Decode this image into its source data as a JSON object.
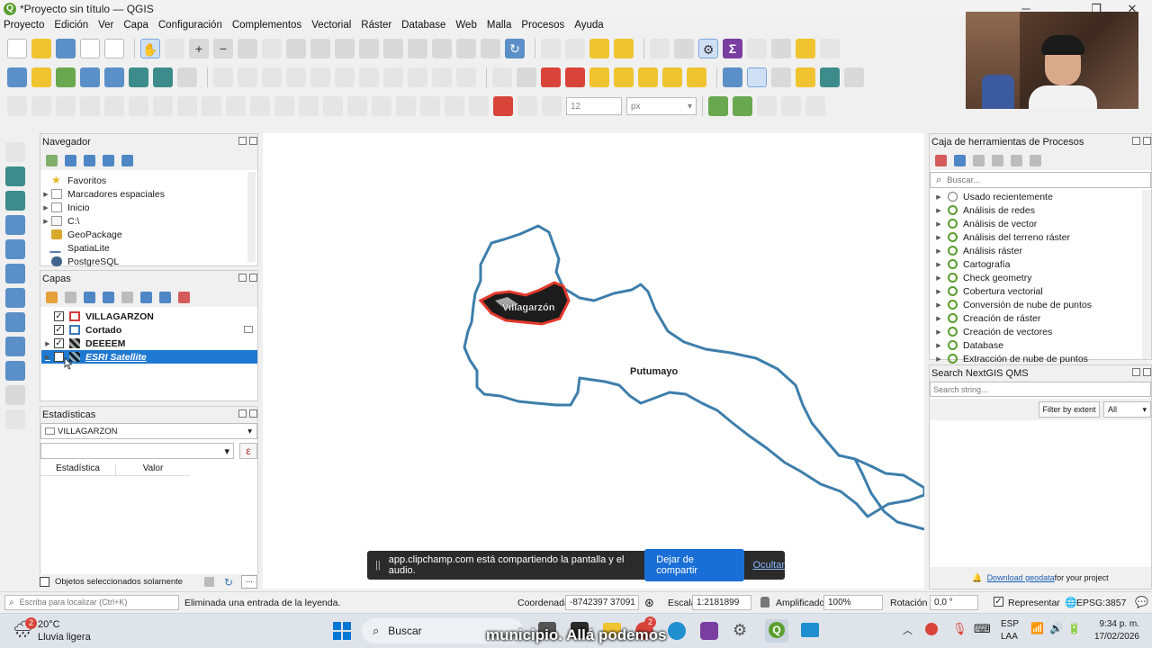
{
  "window": {
    "title": "*Proyecto sin título — QGIS",
    "minimize": "─",
    "maximize": "❐",
    "close": "✕"
  },
  "menu": [
    "Proyecto",
    "Edición",
    "Ver",
    "Capa",
    "Configuración",
    "Complementos",
    "Vectorial",
    "Ráster",
    "Database",
    "Web",
    "Malla",
    "Procesos",
    "Ayuda"
  ],
  "toolbar": {
    "font_size_value": "12",
    "unit_value": "px"
  },
  "navigator": {
    "title": "Navegador",
    "items": [
      {
        "label": "Favoritos",
        "icon": "star-icon",
        "expandable": false
      },
      {
        "label": "Marcadores espaciales",
        "icon": "bookmark-icon",
        "expandable": true
      },
      {
        "label": "Inicio",
        "icon": "folder-icon",
        "expandable": true
      },
      {
        "label": "C:\\",
        "icon": "drive-icon",
        "expandable": true
      },
      {
        "label": "GeoPackage",
        "icon": "geopackage-icon",
        "expandable": false
      },
      {
        "label": "SpatiaLite",
        "icon": "spatialite-icon",
        "expandable": false
      },
      {
        "label": "PostgreSQL",
        "icon": "postgresql-icon",
        "expandable": false
      }
    ]
  },
  "layers": {
    "title": "Capas",
    "items": [
      {
        "label": "VILLAGARZON",
        "checked": true,
        "symbol": "polygon-red-outline",
        "selected": false
      },
      {
        "label": "Cortado",
        "checked": true,
        "symbol": "polygon-blue-outline",
        "selected": false
      },
      {
        "label": "DEEEEM",
        "checked": true,
        "symbol": "raster",
        "selected": false
      },
      {
        "label": "ESRI Satellite",
        "checked": false,
        "symbol": "raster",
        "selected": true
      }
    ]
  },
  "stats": {
    "title": "Estadísticas",
    "layer_value": "VILLAGARZON",
    "expr_button": "ε",
    "col_stat": "Estadística",
    "col_value": "Valor",
    "selected_only_label": "Objetos seleccionados solamente",
    "more_button": "..."
  },
  "map": {
    "label_villagarzon": "Villagarzón",
    "label_putumayo": "Putumayo"
  },
  "share": {
    "message": "app.clipchamp.com está compartiendo la pantalla y el audio.",
    "stop_button": "Dejar de compartir",
    "hide_button": "Ocultar",
    "grip": "||"
  },
  "processing": {
    "title": "Caja de herramientas de Procesos",
    "search_placeholder": "Buscar...",
    "items": [
      "Usado recientemente",
      "Análisis de redes",
      "Análisis de vector",
      "Análisis del terreno ráster",
      "Análisis ráster",
      "Cartografía",
      "Check geometry",
      "Cobertura vectorial",
      "Conversión de nube de puntos",
      "Creación de ráster",
      "Creación de vectores",
      "Database",
      "Extracción de nube de puntos"
    ]
  },
  "nextgis": {
    "title": "Search NextGIS QMS",
    "search_placeholder": "Search string...",
    "filter_button": "Filter by extent",
    "filter_value": "All",
    "download_link": "Download geodata",
    "download_suffix": " for your project"
  },
  "status": {
    "locator_placeholder": "Escriba para localizar (Ctrl+K)",
    "message": "Eliminada una entrada de la leyenda.",
    "coord_label": "Coordenada",
    "coord_value": "-8742397  37091",
    "scale_label": "Escala",
    "scale_value": "1:2181899",
    "magnifier_label": "Amplificador",
    "magnifier_value": "100%",
    "rotation_label": "Rotación",
    "rotation_value": "0,0 °",
    "render_label": "Representar",
    "epsg": "EPSG:3857"
  },
  "taskbar": {
    "weather_temp": "20°C",
    "weather_desc": "Lluvia ligera",
    "weather_badge": "2",
    "search_label": "Buscar",
    "lang_top": "ESP",
    "lang_bottom": "LAA",
    "time": "9:34 p. m.",
    "date": "17/02/2026",
    "app_badge": "2"
  },
  "caption": "municipio. Allá podemos"
}
